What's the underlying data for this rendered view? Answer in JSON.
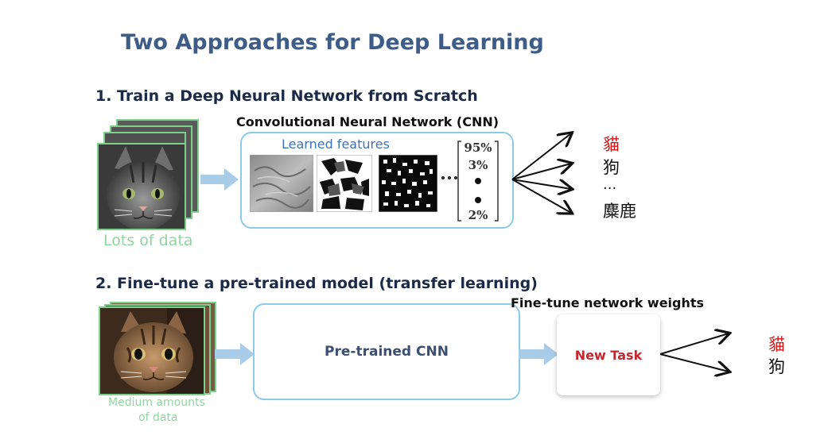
{
  "title": "Two Approaches for Deep Learning",
  "approach1": {
    "heading": "1. Train a Deep Neural Network from Scratch",
    "cnn_label": "Convolutional Neural Network (CNN)",
    "features_label": "Learned features",
    "data_label": "Lots of data",
    "probs": [
      "95%",
      "3%",
      "2%"
    ],
    "outputs": [
      {
        "text": "貓",
        "color": "#d01818"
      },
      {
        "text": "狗",
        "color": "#111111"
      },
      {
        "text": "...",
        "color": "#111111"
      },
      {
        "text": "麋鹿",
        "color": "#111111"
      }
    ]
  },
  "approach2": {
    "heading": "2. Fine-tune a pre-trained model (transfer learning)",
    "pretrained_label": "Pre-trained CNN",
    "finetune_label": "Fine-tune network weights",
    "newtask_label": "New Task",
    "data_label_line1": "Medium amounts",
    "data_label_line2": "of data",
    "outputs": [
      {
        "text": "貓",
        "color": "#d01818"
      },
      {
        "text": "狗",
        "color": "#111111"
      }
    ]
  },
  "colors": {
    "title": "#3d5c88",
    "box_border": "#8ccbe8",
    "arrow_fill": "#a9cde9",
    "stack_border": "#7bd08c",
    "new_task": "#c4282e"
  },
  "icons": [
    "cat-photo",
    "feature-map",
    "right-arrow",
    "output-arrow"
  ]
}
